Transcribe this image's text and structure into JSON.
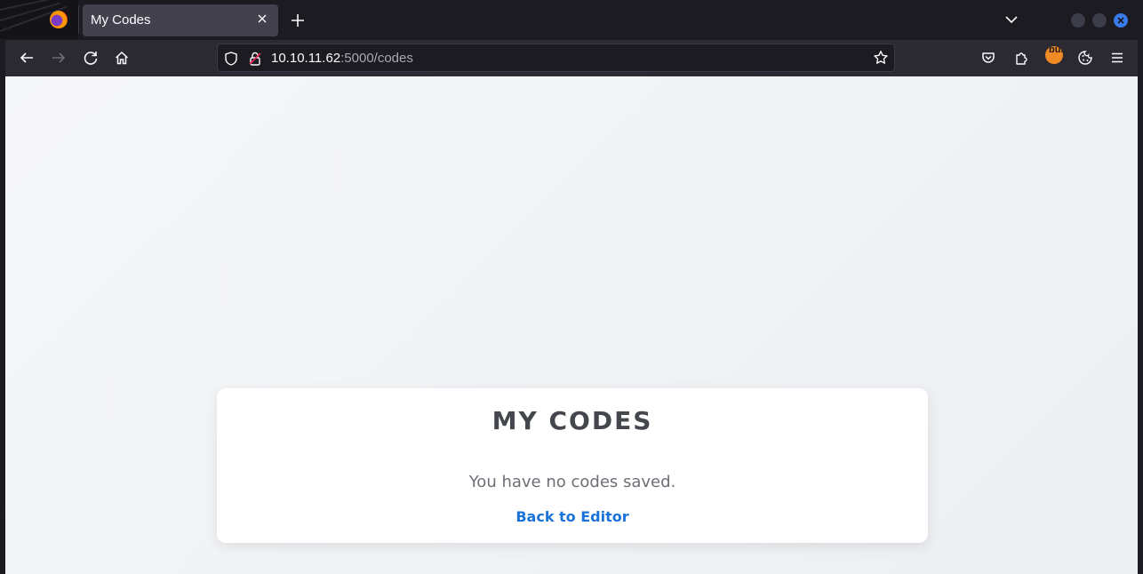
{
  "browser": {
    "tab": {
      "title": "My Codes"
    },
    "url": {
      "host": "10.10.11.62",
      "path": ":5000/codes"
    },
    "extensions": {
      "burp_label": "burp"
    },
    "colors": {
      "accent": "#3a7bea",
      "tab_bg": "#42414d",
      "toolbar_bg": "#2b2a33"
    }
  },
  "page": {
    "title": "MY CODES",
    "message": "You have no codes saved.",
    "link_label": "Back to Editor",
    "colors": {
      "link": "#1a73d9",
      "title": "#44474d",
      "text": "#6b6f76"
    }
  }
}
